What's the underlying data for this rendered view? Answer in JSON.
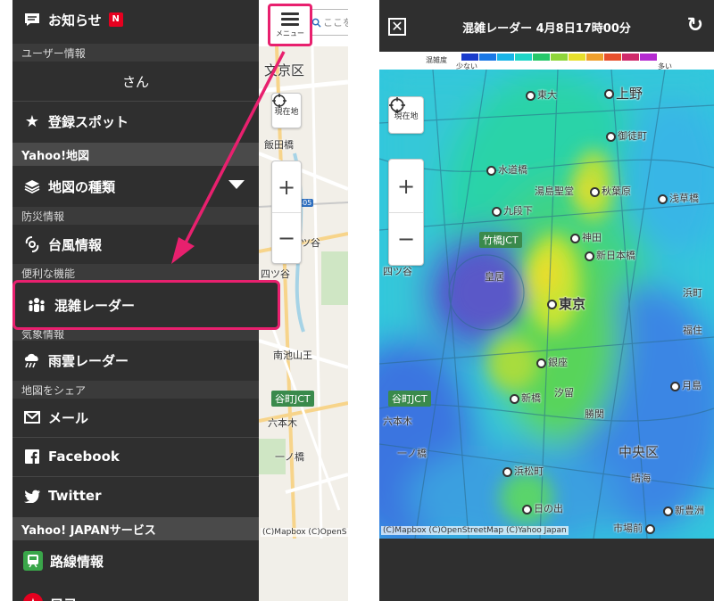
{
  "left": {
    "menu_label": "メニュー",
    "search_placeholder": "ここを",
    "drawer": {
      "notice": {
        "label": "お知らせ",
        "badge": "N"
      },
      "user_section": "ユーザー情報",
      "user_name": "さん",
      "registered_spots": "登録スポット",
      "yahoo_map_section": "Yahoo!地図",
      "map_type": "地図の種類",
      "disaster_section": "防災情報",
      "typhoon": "台風情報",
      "useful_section": "便利な機能",
      "congestion": "混雑レーダー",
      "weather_section": "気象情報",
      "rain_radar": "雨雲レーダー",
      "share_section": "地図をシェア",
      "mail": "メール",
      "facebook": "Facebook",
      "twitter": "Twitter",
      "services_section": "Yahoo! JAPANサービス",
      "route_info": "路線情報",
      "loco": "ロコ"
    },
    "map": {
      "current_location": "現在地",
      "labels": [
        "文京区",
        "飯田橋",
        "四ツ谷",
        "四ツ谷",
        "六本木",
        "一ノ橋",
        "南池山王"
      ],
      "jct": "谷町JCT",
      "route_shield": "405",
      "credit": "(C)Mapbox (C)OpenS"
    }
  },
  "right": {
    "title": "混雑レーダー 4月8日17時00分",
    "legend": {
      "label": "混雑度",
      "low": "少ない",
      "high": "多い"
    },
    "legend_colors": [
      "#1a3ccc",
      "#1a78e6",
      "#19b5e8",
      "#1fd6c8",
      "#27c86a",
      "#8fd63a",
      "#e8e02c",
      "#f0a02c",
      "#e8502c",
      "#d02a6a",
      "#b42ad0"
    ],
    "current_location": "現在地",
    "labels": [
      "上野",
      "東大",
      "御徒町",
      "湯島聖堂",
      "秋葉原",
      "水道橋",
      "九段下",
      "浅草橋",
      "竹橋JCT",
      "神田",
      "新日本橋",
      "皇居",
      "東京",
      "四ツ谷",
      "浜町",
      "福住",
      "銀座",
      "新橋",
      "谷町JCT",
      "汐留",
      "六本木",
      "勝関",
      "中央区",
      "一ノ橋",
      "浜松町",
      "晴海",
      "日の出",
      "市場前",
      "新豊洲",
      "月島"
    ],
    "credit": "(C)Mapbox (C)OpenStreetMap (C)Yahoo Japan"
  },
  "colors": {
    "accent": "#e8206e",
    "drawer_bg": "#2f2f2f",
    "badge": "#e6001f"
  }
}
